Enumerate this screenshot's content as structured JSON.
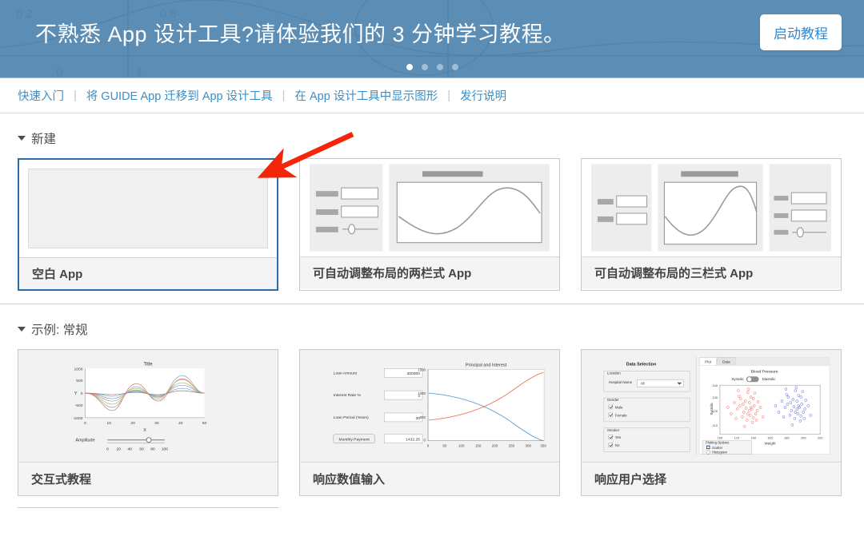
{
  "banner": {
    "title": "不熟悉 App 设计工具?请体验我们的 3 分钟学习教程。",
    "button_label": "启动教程",
    "bg_color": "#5b8db5",
    "button_text_color": "#2e8ad4",
    "dots": [
      {
        "active": true
      },
      {
        "active": false
      },
      {
        "active": false
      },
      {
        "active": false
      }
    ]
  },
  "linkbar": {
    "links": [
      {
        "label": "快速入门"
      },
      {
        "label": "将 GUIDE App 迁移到 App 设计工具"
      },
      {
        "label": "在 App 设计工具中显示图形"
      },
      {
        "label": "发行说明"
      }
    ],
    "separator": "|",
    "link_color": "#3b8ec6"
  },
  "sections": [
    {
      "id": "new",
      "title": "新建",
      "expanded": true,
      "cards": [
        {
          "label": "空白 App",
          "thumb": "blank",
          "selected": true
        },
        {
          "label": "可自动调整布局的两栏式 App",
          "thumb": "two-column",
          "selected": false
        },
        {
          "label": "可自动调整布局的三栏式 App",
          "thumb": "three-column",
          "selected": false
        }
      ]
    },
    {
      "id": "examples-general",
      "title": "示例: 常规",
      "expanded": true,
      "cards": [
        {
          "label": "交互式教程",
          "thumb": "tutorial",
          "selected": false
        },
        {
          "label": "响应数值输入",
          "thumb": "loan",
          "selected": false
        },
        {
          "label": "响应用户选择",
          "thumb": "selection",
          "selected": false
        }
      ]
    }
  ],
  "annotation": {
    "type": "arrow",
    "color": "#f42508",
    "points_to": "空白 App"
  },
  "thumbnails": {
    "tutorial": {
      "chart_title": "Title",
      "xlabel": "X",
      "ylabel": "Y",
      "yticks": [
        "1000",
        "500",
        "0",
        "-500",
        "-1000"
      ],
      "xticks": [
        "0",
        "10",
        "20",
        "30",
        "40",
        "50"
      ],
      "slider_label": "Amplitude",
      "slider_ticks": [
        "0",
        "20",
        "40",
        "60",
        "80",
        "100"
      ],
      "slider_value": 72
    },
    "loan": {
      "chart_title": "Principal and Interest",
      "yticks": [
        "1500",
        "1000",
        "500",
        "0"
      ],
      "xticks": [
        "0",
        "50",
        "100",
        "150",
        "200",
        "250",
        "300",
        "350"
      ],
      "fields": [
        {
          "label": "Loan Amount",
          "value": "300000"
        },
        {
          "label": "Interest Rate %",
          "value": "4"
        },
        {
          "label": "Loan Period (Years)",
          "value": "30"
        }
      ],
      "button_label": "Monthly Payment",
      "result_value": "1432.25",
      "series_colors": [
        "#5b9bd5",
        "#e8795a"
      ]
    },
    "selection": {
      "panel_title": "Data Selection",
      "tabs": [
        {
          "label": "Plot",
          "active": true
        },
        {
          "label": "Data",
          "active": false
        }
      ],
      "groups": [
        {
          "title": "Location",
          "type": "dropdown",
          "field_label": "Hospital Name",
          "value": "All"
        },
        {
          "title": "Gender",
          "type": "checkbox",
          "options": [
            {
              "label": "Male",
              "checked": true
            },
            {
              "label": "Female",
              "checked": true
            }
          ]
        },
        {
          "title": "Smoker",
          "type": "checkbox",
          "options": [
            {
              "label": "Yes",
              "checked": true
            },
            {
              "label": "No",
              "checked": true
            }
          ]
        }
      ],
      "chart_title": "Blood Pressure",
      "toggle_left": "Systolic",
      "toggle_right": "Diastolic",
      "xlabel": "Weight",
      "ylabel": "Systolic",
      "xticks": [
        "100",
        "120",
        "140",
        "160",
        "180",
        "200",
        "220"
      ],
      "yticks": [
        "110",
        "120",
        "130",
        "140"
      ],
      "plotting_options_title": "Plotting Options",
      "plotting_options": [
        {
          "label": "Scatter",
          "selected": true
        },
        {
          "label": "Histogram",
          "selected": false
        }
      ],
      "series_colors": [
        "#e8443a",
        "#3a45cf"
      ]
    }
  }
}
